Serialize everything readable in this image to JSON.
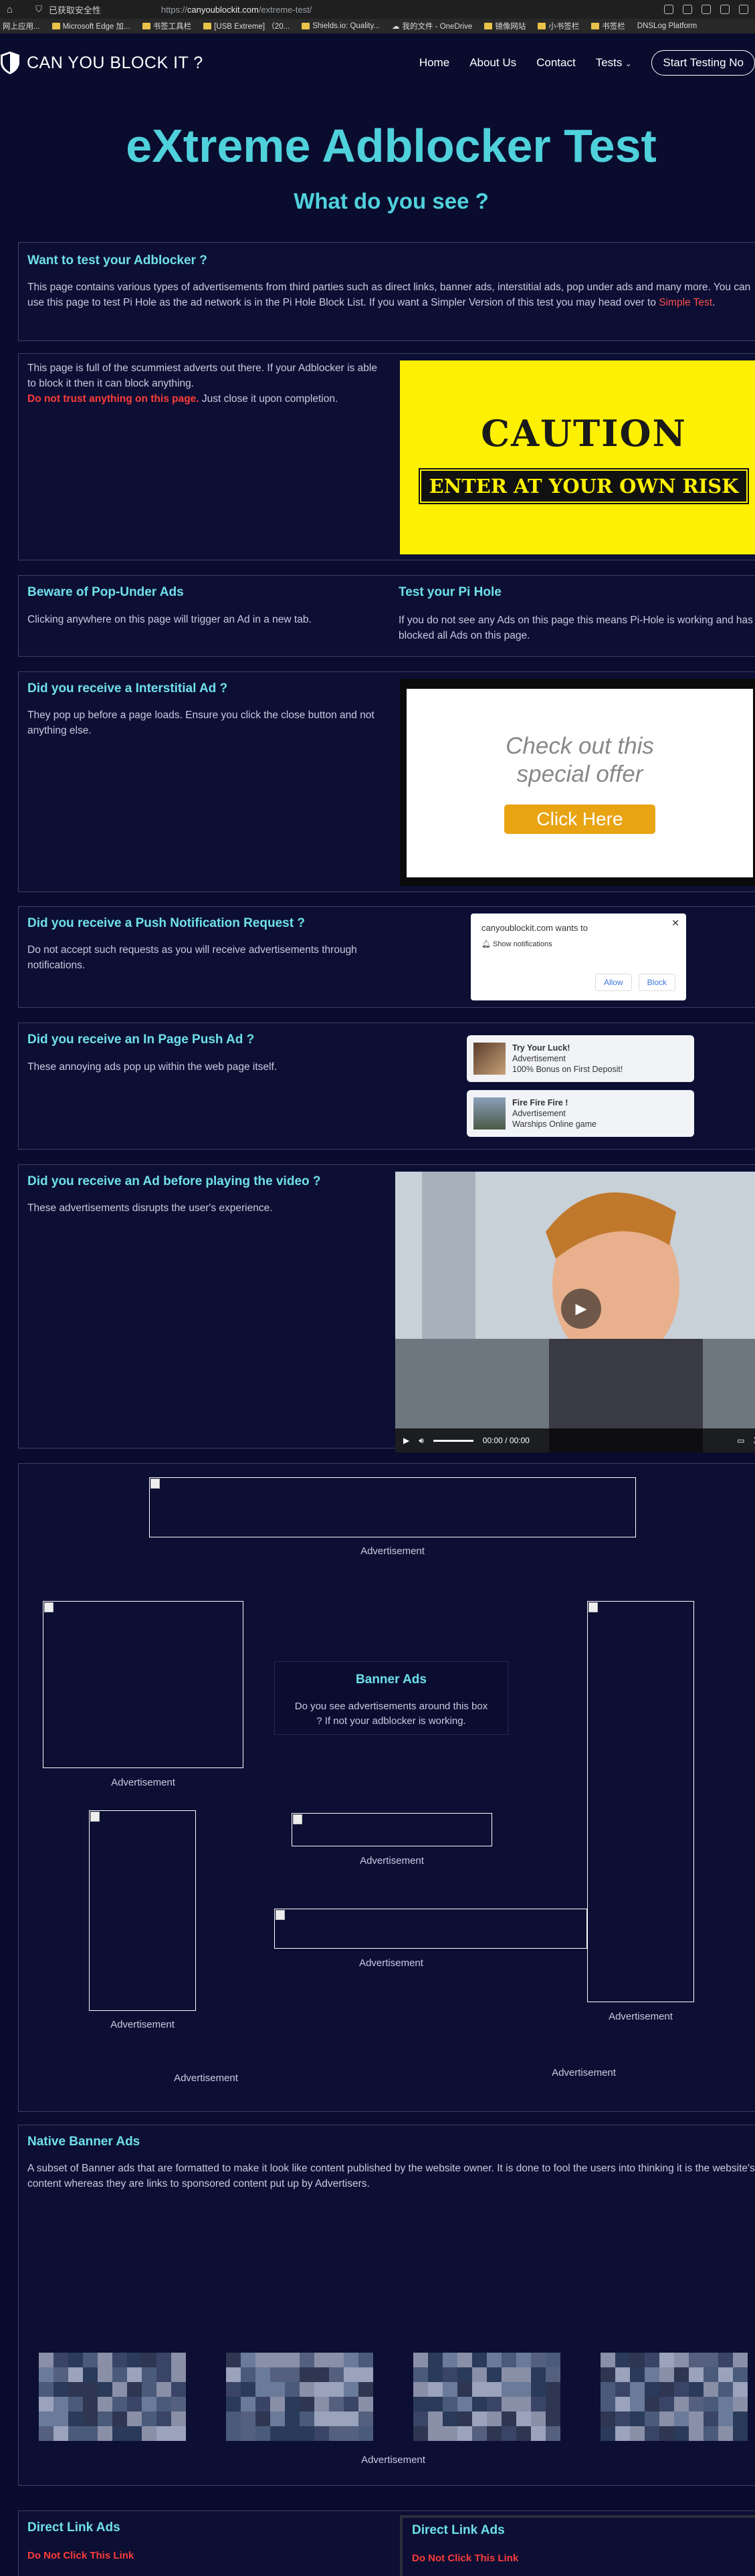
{
  "browser": {
    "tab_security": "已获取安全性",
    "url_prefix": "https://",
    "url_host": "canyoublockit.com",
    "url_path": "/extreme-test/",
    "bookmarks": [
      "网上应用...",
      "Microsoft Edge 加...",
      "书签工具栏",
      "[USB Extreme] （20...",
      "Shields.io: Quality...",
      "我的文件 - OneDrive",
      "镜像网站",
      "小书签栏",
      "书签栏",
      "DNSLog Platform"
    ]
  },
  "nav": {
    "logo_text": "CAN YOU BLOCK IT ?",
    "links": [
      "Home",
      "About Us",
      "Contact",
      "Tests"
    ],
    "cta": "Start Testing No"
  },
  "hero": {
    "title": "eXtreme Adblocker Test",
    "subtitle": "What do you see ?"
  },
  "intro": {
    "title": "Want to test your Adblocker ?",
    "body": "This page contains various types of advertisements from third parties such as direct links, banner ads, interstitial ads, pop under ads and many more. You can use this page to test Pi Hole as the ad network is in the Pi Hole Block List. If you want a Simpler Version of this test you may head over to ",
    "link": "Simple Test",
    "end": "."
  },
  "warning": {
    "body": "This page is full of the scummiest adverts out there. If your Adblocker is able to block it then it can block anything.",
    "bold": "Do not trust anything on this page.",
    "tail": " Just close it upon completion.",
    "caution_title": "CAUTION",
    "caution_sub": "ENTER AT YOUR OWN RISK"
  },
  "popunder": {
    "title": "Beware of Pop-Under Ads",
    "body": "Clicking anywhere on this page will trigger an Ad in a new tab.",
    "title2": "Test your Pi Hole",
    "body2": "If you do not see any Ads on this page this means Pi-Hole is working and has blocked all Ads on this page."
  },
  "interstitial": {
    "title": "Did you receive a Interstitial Ad ?",
    "body": "They pop up before a page loads. Ensure you click the close button and not anything else.",
    "offer": "Check out this special offer",
    "click": "Click Here"
  },
  "push": {
    "title": "Did you receive a Push Notification Request ?",
    "body": "Do not accept such requests as you will receive advertisements through notifications.",
    "site": "canyoublockit.com wants to",
    "perm": "Show notifications",
    "allow": "Allow",
    "block": "Block"
  },
  "inpage": {
    "title": "Did you receive an In Page Push Ad ?",
    "body": "These annoying ads pop up within the web page itself.",
    "ads": [
      {
        "title": "Try Your Luck!",
        "tag": "Advertisement",
        "text": "100% Bonus on First Deposit!"
      },
      {
        "title": "Fire Fire Fire !",
        "tag": "Advertisement",
        "text": "Warships Online game"
      }
    ]
  },
  "video": {
    "title": "Did you receive an Ad before playing the video ?",
    "body": "These advertisements disrupts the user's experience.",
    "time": "00:00 / 00:00"
  },
  "banners": {
    "label": "Advertisement",
    "box_title": "Banner Ads",
    "box_body": "Do you see advertisements around this box ? If not your adblocker is working."
  },
  "native": {
    "title": "Native Banner Ads",
    "body": "A subset of Banner ads that are formatted to make it look like content published by the website owner. It is done to fool the users into thinking it is the website's content whereas they are links to sponsored content put up by Advertisers.",
    "label": "Advertisement"
  },
  "direct": {
    "title": "Direct Link Ads",
    "link": "Do Not Click This Link",
    "title2": "Direct Link Ads",
    "link2": "Do Not Click This Link"
  },
  "colors": {
    "accent": "#4fd1dc",
    "warning": "#ff3b3b",
    "bg": "#0a0c2e",
    "caution": "#fef002"
  }
}
